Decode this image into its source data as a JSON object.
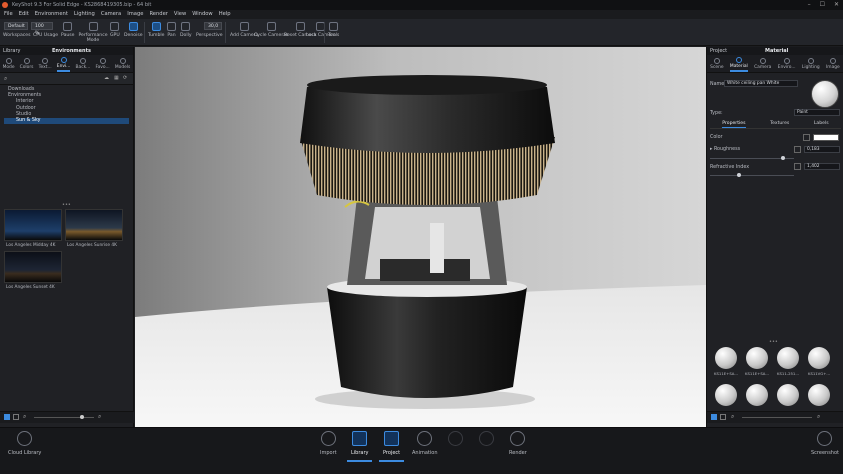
{
  "titlebar": {
    "title": "KeyShot 9.3 For Solid Edge - KS2868419305.bip - 64 bit"
  },
  "menu": [
    "File",
    "Edit",
    "Environment",
    "Lighting",
    "Camera",
    "Image",
    "Render",
    "View",
    "Window",
    "Help"
  ],
  "toolbar": {
    "preset": "Default",
    "zoom": "100 %",
    "buttons": [
      "Workspaces",
      "CPU Usage",
      "Pause",
      "Performance Mode",
      "GPU",
      "Denoise",
      "Tumble",
      "Pan",
      "Dolly",
      "Perspective",
      "Add Camera",
      "Cycle Cameras",
      "Reset Camera",
      "Lock Camera",
      "Tools"
    ],
    "fov": "30,0"
  },
  "left": {
    "header": "Library",
    "title": "Environments",
    "tabs": [
      "Mode",
      "Colors",
      "Text...",
      "Envi...",
      "Back...",
      "Favo...",
      "Models"
    ],
    "tree": [
      "Downloads",
      "Environments",
      "Interior",
      "Outdoor",
      "Studio",
      "Sun & Sky"
    ],
    "thumbs": [
      "Los Angeles Midday 4K",
      "Los Angeles Sunrise 4K",
      "Los Angeles Sunset 4K"
    ]
  },
  "right": {
    "header_left": "Project",
    "header_title": "Material",
    "tabs": [
      "Scene",
      "Material",
      "Camera",
      "Enviro...",
      "Lighting",
      "Image"
    ],
    "name_label": "Name:",
    "name_value": "White ceiling pan White",
    "type_label": "Type:",
    "type_value": "Paint",
    "subtabs": [
      "Properties",
      "Textures",
      "Labels"
    ],
    "color_label": "Color",
    "roughness_label": "Roughness",
    "roughness_value": "0,183",
    "ri_label": "Refractive Index",
    "ri_value": "1,402",
    "balls": [
      "KS11E+SA...",
      "KS11E+SA...",
      "KS11-251...",
      "KS11VG+..."
    ]
  },
  "bottom": {
    "left_label": "Cloud Library",
    "buttons": [
      "Import",
      "Library",
      "Project",
      "Animation",
      "",
      "",
      "Render"
    ],
    "right_label": "Screenshot"
  },
  "colors": {
    "accent": "#3c8be0",
    "panel": "#202125",
    "bg": "#1b1c1f"
  }
}
